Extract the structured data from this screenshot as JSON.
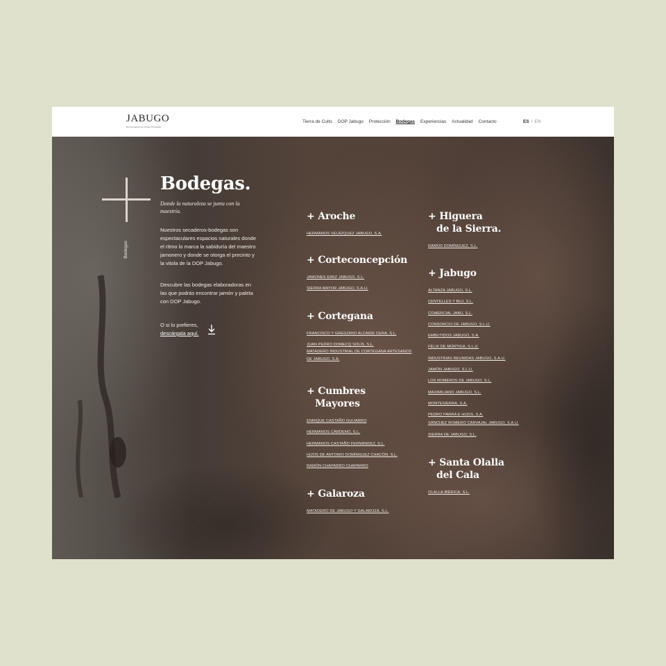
{
  "header": {
    "logo": "JABUGO",
    "logo_tagline": "Denominación de Origen Protegida",
    "nav": [
      "Tierra de Culto",
      "DOP Jabugo",
      "Protección",
      "Bodegas",
      "Experiencias",
      "Actualidad",
      "Contacto"
    ],
    "active_nav": "Bodegas",
    "lang_es": "ES",
    "lang_sep": "/",
    "lang_en": "EN"
  },
  "intro": {
    "title": "Bodegas.",
    "vertical_label": "Bodegas",
    "subtitle": "Donde la naturaleza se junta con la maestría.",
    "paragraph1": "Nuestros secaderos-bodegas son espectaculares espacios naturales donde el ritmo lo marca la sabiduría del maestro jamonero y donde se otorga el precinto y la vitola de la DOP Jabugo.",
    "paragraph2": "Descubre las bodegas elaboradoras en las que podrás encontrar jamón y paleta con DOP Jabugo.",
    "download_text": "O si lo prefieres,",
    "download_link": "descárgala aquí."
  },
  "groups": [
    {
      "line1": "+ Aroche",
      "line2": "",
      "items": [
        "HERMANOS VELÁZQUEZ JABUGO, S.A."
      ]
    },
    {
      "line1": "+ Corteconcepción",
      "line2": "",
      "items": [
        "JAMONES EIRIZ JABUGO, S.L.",
        "SIERRA MAYOR JABUGO, S.A.U."
      ]
    },
    {
      "line1": "+ Cortegana",
      "line2": "",
      "items": [
        "FRANCISCO Y GREGORIO ALCAIDE CERA, S.L.",
        "JUAN PEDRO DOMECQ SOLÍS, S.L.",
        "MATADERO INDUSTRIAL DE CORTEGANA ARTESANOS DE JABUGO, S.A."
      ]
    },
    {
      "line1": "+ Cumbres",
      "line2": "Mayores",
      "items": [
        "ENRIQUE CASTAÑO GUIJARRO",
        "HERMANOS CÁRDENO, S.L.",
        "HERMANOS CASTAÑO FERNÁNDEZ, S.L.",
        "HIJOS DE ANTONIO DOMÍNGUEZ CHACÓN, S.L.",
        "RAMÓN CHAPARRO CHAPARRO"
      ]
    },
    {
      "line1": "+ Galaroza",
      "line2": "",
      "items": [
        "MATADERO DE JABUGO Y GALAROZA, S.L."
      ]
    },
    {
      "line1": "+ Higuera",
      "line2": "de la Sierra.",
      "items": [
        "RAMOS DOMÍNGUEZ, S.L."
      ]
    },
    {
      "line1": "+ Jabugo",
      "line2": "",
      "items": [
        "ALTANZA JABUGO, S.L.",
        "CENTELLES Y BUJ, S.L.",
        "COMERCIAL JABU, S.L.",
        "CONSORCIO DE JABUGO, S.L.U.",
        "EMBUTIDOS JABUGO, S.A.",
        "FÉLIX DE MÚRTIGA, S.L.U.",
        "INDUSTRIAS REUNIDAS JABUGO, S.A.U.",
        "JAMÓN JABUGO, S.L.U.",
        "LOS ROMEROS DE JABUGO, S.L.",
        "MAXIMILIANO JABUGO, S.L.",
        "MONTESIERRA, S.A.",
        "PEDRO PARRA E HIJOS, S.A.",
        "SÁNCHEZ ROMERO CARVAJAL JABUGO, S.A.U.",
        "SIERRA DE JABUGO, S.L."
      ]
    },
    {
      "line1": "+ Santa Olalla",
      "line2": "del Cala",
      "items": [
        "OLALLA IBÉRICA, S.L."
      ]
    }
  ],
  "colors": {
    "page_bg": "#dfe1cd",
    "header_bg": "#ffffff",
    "hero_dark": "#3b302b",
    "text_light": "#f3eee9"
  },
  "icons": {
    "download": "download-arrow-icon"
  }
}
